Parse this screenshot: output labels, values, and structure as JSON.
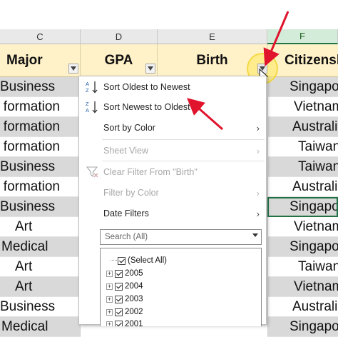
{
  "column_letters": [
    "C",
    "D",
    "E",
    "F"
  ],
  "headers": {
    "major": "Major",
    "gpa": "GPA",
    "birth": "Birth",
    "citizenship": "Citizensh"
  },
  "major_cells": [
    "Business",
    "formation",
    "formation",
    "formation",
    "Business",
    "formation",
    "Business",
    "Art",
    "Medical",
    "Art",
    "Art",
    "Business",
    "Medical"
  ],
  "citizenship_cells": [
    "Singapo",
    "Vietnam",
    "Australi",
    "Taiwan",
    "Taiwan",
    "Australi",
    "Singapo",
    "Vietnam",
    "Singapo",
    "Taiwan",
    "Vietnam",
    "Australi",
    "Singapo"
  ],
  "filter_menu": {
    "sort_oldest": "Sort Oldest to Newest",
    "sort_newest": "Sort Newest to Oldest",
    "sort_by_color": "Sort by Color",
    "sheet_view": "Sheet View",
    "clear_filter": "Clear Filter From \"Birth\"",
    "filter_by_color": "Filter by Color",
    "date_filters": "Date Filters",
    "search_placeholder": "Search (All)",
    "tree_items": [
      "(Select All)",
      "2005",
      "2004",
      "2003",
      "2002",
      "2001"
    ]
  },
  "colors": {
    "header_bg": "#fff2c9",
    "grey_row": "#d9d9d9",
    "selected_col": "#217346",
    "annotation_red": "#e0142c",
    "highlight": "#ffe85a"
  },
  "icons": [
    "sort-ascending-icon",
    "sort-descending-icon",
    "clear-filter-icon",
    "filter-dropdown-icon",
    "submenu-arrow-icon",
    "cursor-icon"
  ]
}
